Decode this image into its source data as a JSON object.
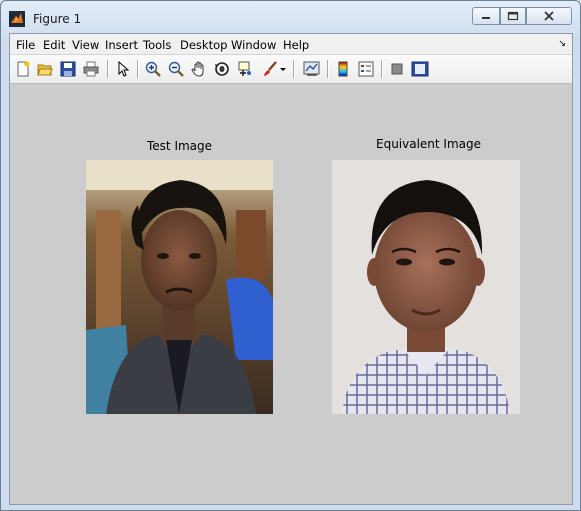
{
  "window": {
    "title": "Figure 1"
  },
  "menu": [
    "File",
    "Edit",
    "View",
    "Insert",
    "Tools",
    "Desktop",
    "Window",
    "Help"
  ],
  "toolbar_icons": [
    "new-figure-icon",
    "open-file-icon",
    "save-icon",
    "print-icon",
    "edit-plot-arrow-icon",
    "zoom-in-icon",
    "zoom-out-icon",
    "pan-hand-icon",
    "rotate-3d-icon",
    "data-cursor-icon",
    "brush-icon",
    "dropdown-arrow-icon",
    "link-plot-icon",
    "colorbar-icon",
    "legend-icon",
    "hide-plot-tools-icon",
    "show-plot-tools-icon"
  ],
  "axes": [
    {
      "title": "Test Image"
    },
    {
      "title": "Equivalent Image"
    }
  ],
  "colors": {
    "figure_bg": "#cccccc",
    "titlebar": "#dbe6f2",
    "menubar": "#f0f0f0"
  }
}
